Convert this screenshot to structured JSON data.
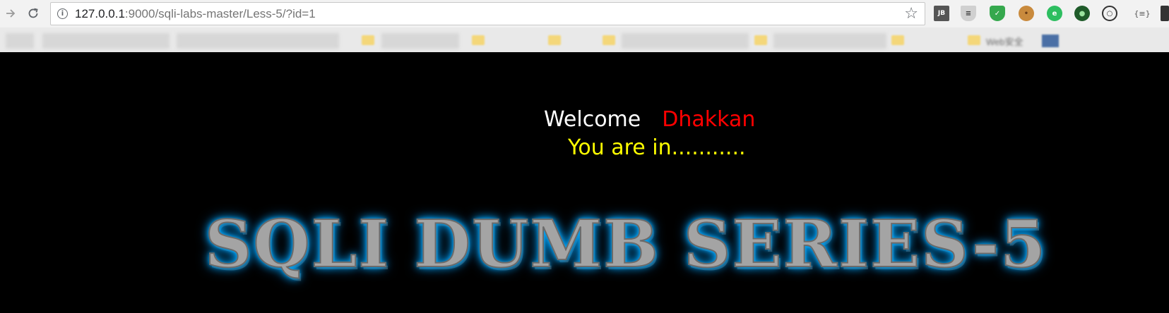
{
  "browser": {
    "address_host": "127.0.0.1",
    "address_rest": ":9000/sqli-labs-master/Less-5/?id=1",
    "forward_icon": "arrow-right-icon",
    "reload_icon": "reload-icon",
    "info_icon": "info-icon",
    "bookmark_star_icon": "star-icon",
    "extensions": {
      "jb": "JB",
      "json": "{≡}"
    }
  },
  "bookmarks": {
    "partial_label": "Web安全"
  },
  "page": {
    "welcome_text": "Welcome",
    "welcome_name": "Dhakkan",
    "status_text": "You are in...........",
    "banner_title": "SQLI DUMB SERIES-5"
  },
  "colors": {
    "background": "#000000",
    "welcome": "#ffffff",
    "name": "#ff0000",
    "status": "#ffff00",
    "banner_glow": "#00aaff"
  }
}
